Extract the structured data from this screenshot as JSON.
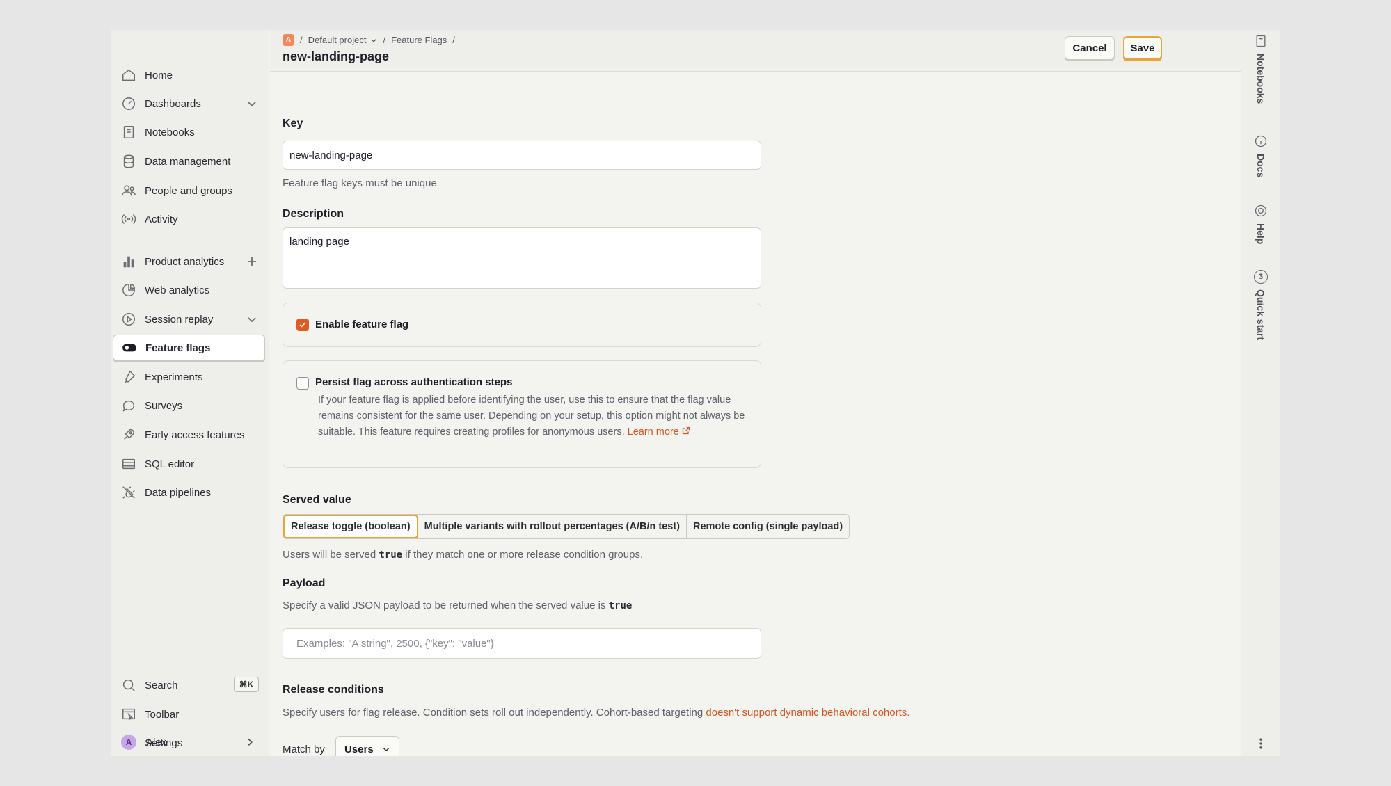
{
  "sidebar": {
    "items": [
      {
        "label": "Home",
        "icon": "home-icon"
      },
      {
        "label": "Dashboards",
        "icon": "dashboard-icon"
      },
      {
        "label": "Notebooks",
        "icon": "notebook-icon"
      },
      {
        "label": "Data management",
        "icon": "database-icon"
      },
      {
        "label": "People and groups",
        "icon": "people-icon"
      },
      {
        "label": "Activity",
        "icon": "activity-icon"
      },
      {
        "label": "Product analytics",
        "icon": "bar-chart-icon"
      },
      {
        "label": "Web analytics",
        "icon": "pie-chart-icon"
      },
      {
        "label": "Session replay",
        "icon": "replay-icon"
      },
      {
        "label": "Feature flags",
        "icon": "toggle-icon"
      },
      {
        "label": "Experiments",
        "icon": "flask-icon"
      },
      {
        "label": "Surveys",
        "icon": "chat-bubble-icon"
      },
      {
        "label": "Early access features",
        "icon": "rocket-icon"
      },
      {
        "label": "SQL editor",
        "icon": "sql-table-icon"
      },
      {
        "label": "Data pipelines",
        "icon": "plug-icon"
      }
    ],
    "bottom": {
      "search": "Search",
      "search_shortcut": "⌘K",
      "toolbar": "Toolbar",
      "settings": "Settings",
      "user_name": "Alex",
      "user_initial": "A"
    }
  },
  "header": {
    "project_badge": "A",
    "project": "Default project",
    "section": "Feature Flags",
    "separator": "/",
    "title": "new-landing-page",
    "cancel_label": "Cancel",
    "save_label": "Save"
  },
  "form": {
    "key_label": "Key",
    "key_value": "new-landing-page",
    "key_help": "Feature flag keys must be unique",
    "description_label": "Description",
    "description_value": "landing page",
    "enable_label": "Enable feature flag",
    "enable_checked": true,
    "persist_label": "Persist flag across authentication steps",
    "persist_checked": false,
    "persist_desc": "If your feature flag is applied before identifying the user, use this to ensure that the flag value remains consistent for the same user. Depending on your setup, this option might not always be suitable. This feature requires creating profiles for anonymous users.",
    "learn_more": "Learn more",
    "served_value_label": "Served value",
    "served_options": [
      "Release toggle (boolean)",
      "Multiple variants with rollout percentages (A/B/n test)",
      "Remote config (single payload)"
    ],
    "served_help_pre": "Users will be served",
    "served_help_code": "true",
    "served_help_post": "if they match one or more release condition groups.",
    "payload_label": "Payload",
    "payload_help_pre": "Specify a valid JSON payload to be returned when the served value is",
    "payload_help_code": "true",
    "payload_placeholder": "Examples: \"A string\", 2500, {\"key\": \"value\"}",
    "release_label": "Release conditions",
    "release_help": "Specify users for flag release. Condition sets roll out independently. Cohort-based targeting",
    "release_link": "doesn't support dynamic behavioral cohorts.",
    "match_by_label": "Match by",
    "match_by_value": "Users"
  },
  "rail": {
    "notebooks": "Notebooks",
    "docs": "Docs",
    "help": "Help",
    "quick_start": "Quick start",
    "quick_start_count": "3"
  },
  "colors": {
    "accent": "#e05a24",
    "primary_border": "#e7a43b"
  }
}
